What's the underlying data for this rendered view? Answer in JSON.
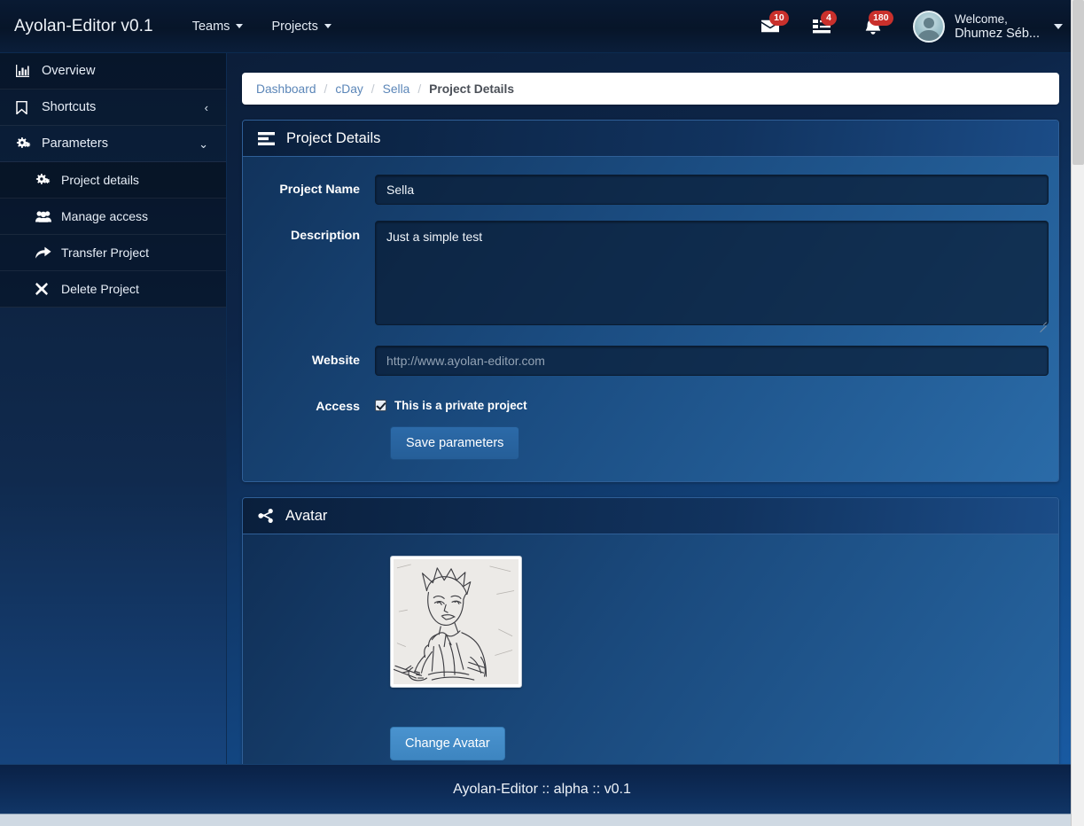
{
  "navbar": {
    "brand": "Ayolan-Editor v0.1",
    "menus": [
      {
        "label": "Teams",
        "icon": "chevron-down-icon"
      },
      {
        "label": "Projects",
        "icon": "chevron-down-icon"
      }
    ],
    "notifications": [
      {
        "icon": "envelope-icon",
        "count": "10"
      },
      {
        "icon": "tasks-icon",
        "count": "4"
      },
      {
        "icon": "bell-icon",
        "count": "180"
      }
    ],
    "user": {
      "greeting": "Welcome,",
      "name": "Dhumez Séb...",
      "avatar_icon": "user-avatar-icon",
      "caret_icon": "chevron-down-icon"
    }
  },
  "sidebar": {
    "items": [
      {
        "label": "Overview",
        "icon": "chart-bar-icon",
        "arrow": "",
        "level": 0,
        "active": false
      },
      {
        "label": "Shortcuts",
        "icon": "bookmark-icon",
        "arrow": "‹",
        "level": 0,
        "active": false
      },
      {
        "label": "Parameters",
        "icon": "gears-icon",
        "arrow": "⌄",
        "level": 0,
        "active": false
      },
      {
        "label": "Project details",
        "icon": "gears-icon",
        "arrow": "",
        "level": 1,
        "active": true
      },
      {
        "label": "Manage access",
        "icon": "users-icon",
        "arrow": "",
        "level": 1,
        "active": false
      },
      {
        "label": "Transfer Project",
        "icon": "share-arrow-icon",
        "arrow": "",
        "level": 1,
        "active": false
      },
      {
        "label": "Delete Project",
        "icon": "times-icon",
        "arrow": "",
        "level": 1,
        "active": false
      }
    ]
  },
  "breadcrumb": {
    "items": [
      {
        "label": "Dashboard",
        "current": false
      },
      {
        "label": "cDay",
        "current": false
      },
      {
        "label": "Sella",
        "current": false
      },
      {
        "label": "Project Details",
        "current": true
      }
    ],
    "separator": "/"
  },
  "project_panel": {
    "title": "Project Details",
    "icon": "align-list-icon",
    "fields": {
      "name_label": "Project Name",
      "name_value": "Sella",
      "name_placeholder": "",
      "description_label": "Description",
      "description_value": "Just a simple test",
      "description_placeholder": "",
      "website_label": "Website",
      "website_value": "",
      "website_placeholder": "http://www.ayolan-editor.com",
      "access_label": "Access",
      "access_checkbox_label": "This is a private project",
      "access_checked": true
    },
    "save_label": "Save parameters"
  },
  "avatar_panel": {
    "title": "Avatar",
    "icon": "share-icon",
    "image_alt": "pencil-sketch-character-avatar",
    "change_label": "Change Avatar"
  },
  "footer": {
    "text": "Ayolan-Editor :: alpha :: v0.1"
  },
  "colors": {
    "badge_red": "#c9302c",
    "breadcrumb_link": "#5b86b8",
    "save_button": "#2c6aa8",
    "change_button": "#4a93cf",
    "panel_border": "#2f5f97"
  }
}
